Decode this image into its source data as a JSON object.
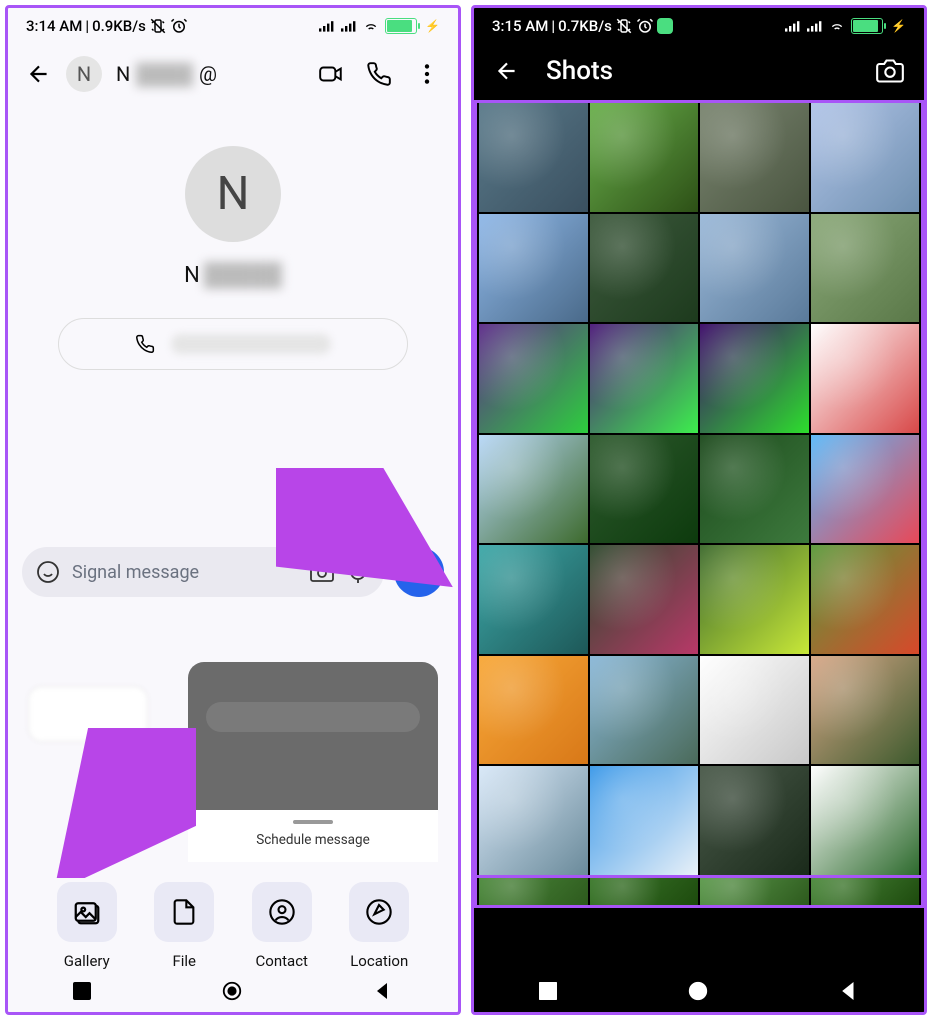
{
  "phone1": {
    "status": {
      "time": "3:14 AM",
      "speed": "0.9KB/s"
    },
    "header": {
      "avatar_letter": "N",
      "name": "N"
    },
    "contact": {
      "avatar_letter": "N",
      "name": "N"
    },
    "input": {
      "placeholder": "Signal message"
    },
    "schedule_label": "Schedule message",
    "attachments": [
      {
        "key": "gallery",
        "label": "Gallery"
      },
      {
        "key": "file",
        "label": "File"
      },
      {
        "key": "contact",
        "label": "Contact"
      },
      {
        "key": "location",
        "label": "Location"
      }
    ]
  },
  "phone2": {
    "status": {
      "time": "3:15 AM",
      "speed": "0.7KB/s"
    },
    "title": "Shots",
    "thumbs_rows": 8,
    "thumbs_cols": 4
  }
}
